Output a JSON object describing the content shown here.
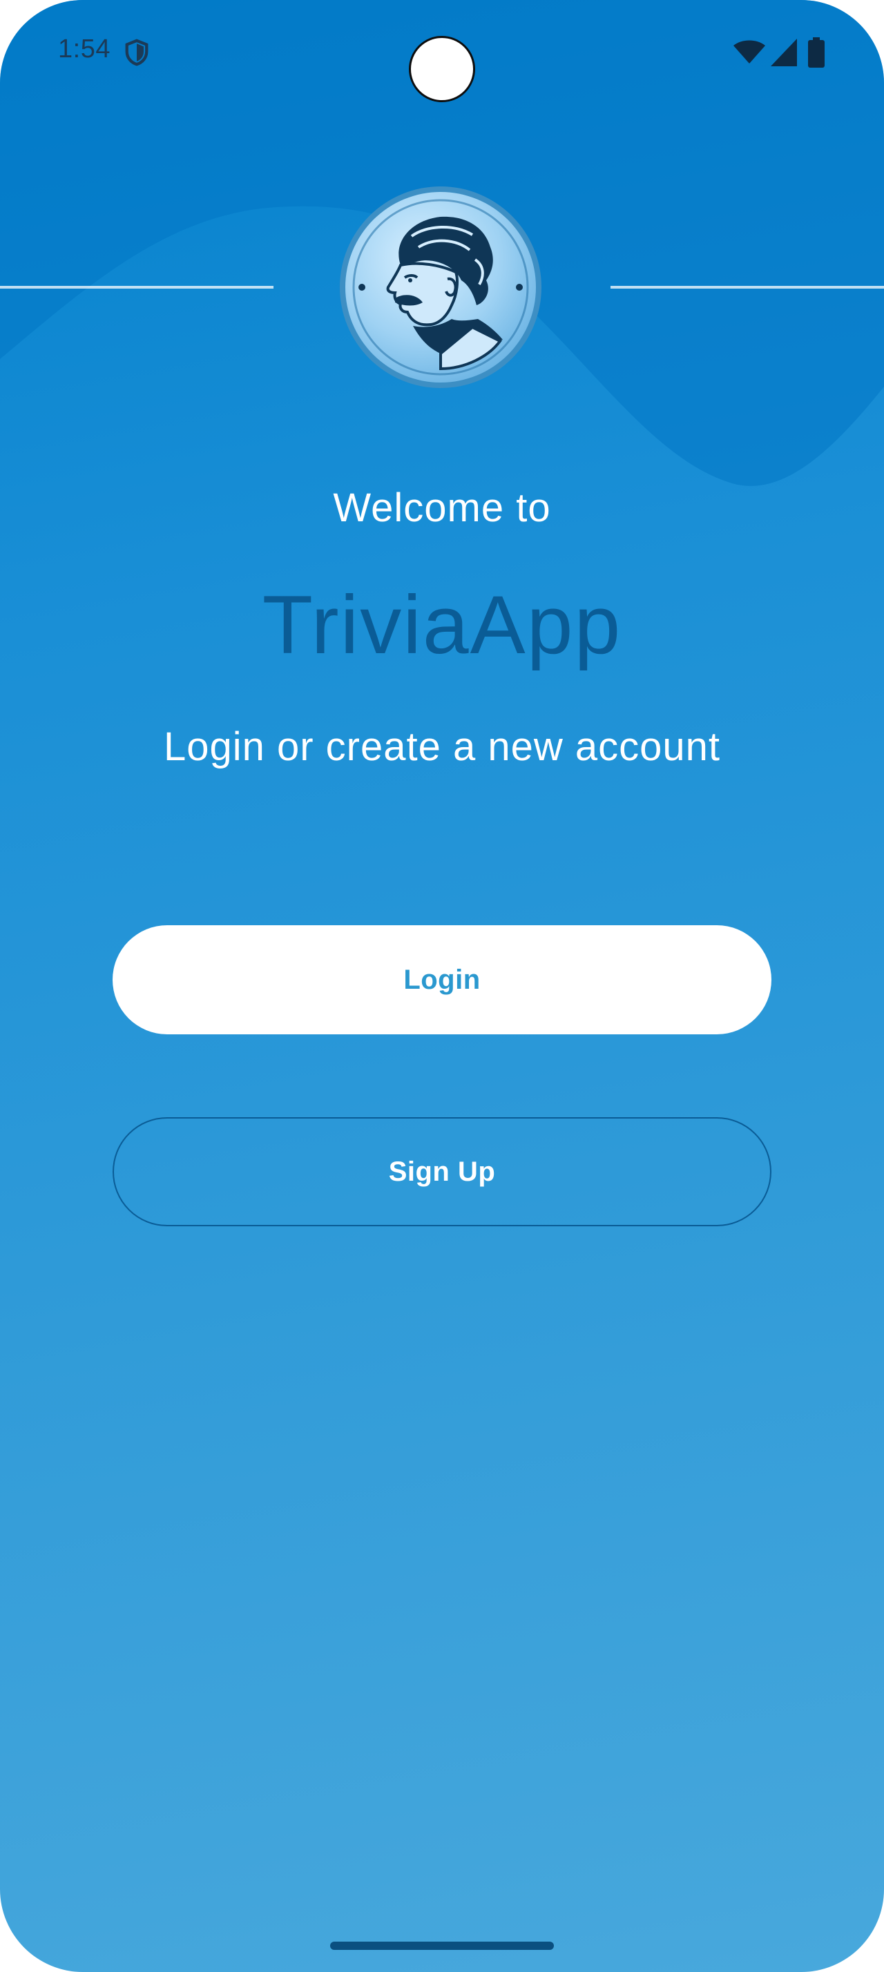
{
  "status_bar": {
    "time": "1:54",
    "icons": [
      "shield-icon",
      "camera-icon",
      "wifi-icon",
      "signal-icon",
      "battery-icon"
    ]
  },
  "header": {
    "logo": "einstein-logo-icon"
  },
  "welcome": {
    "intro": "Welcome to",
    "app_name": "TriviaApp",
    "subtitle": "Login or create a new account"
  },
  "actions": {
    "login_label": "Login",
    "signup_label": "Sign Up"
  },
  "colors": {
    "background_top": "#0380cc",
    "background_bottom": "#48a8dc",
    "app_name": "#0a5c96",
    "login_text": "#2a98cf",
    "button_outline": "#0a5c96"
  }
}
